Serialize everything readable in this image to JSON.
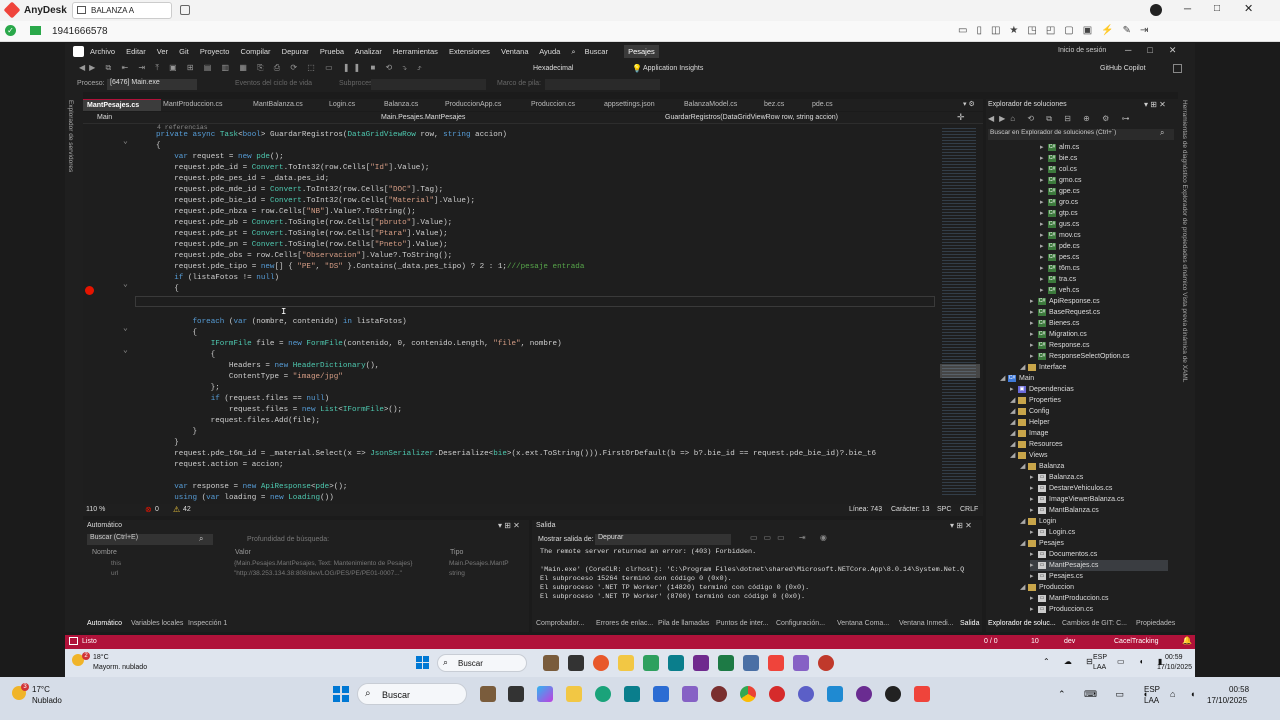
{
  "anydesk": {
    "app_name": "AnyDesk",
    "tab_title": "BALANZA A",
    "address": "1941666578"
  },
  "vs": {
    "menu": [
      "Archivo",
      "Editar",
      "Ver",
      "Git",
      "Proyecto",
      "Compilar",
      "Depurar",
      "Prueba",
      "Analizar",
      "Herramientas",
      "Extensiones",
      "Ventana",
      "Ayuda"
    ],
    "search_label": "Buscar",
    "active_menu": "Pesajes",
    "signin": "Inicio de sesión",
    "copilot": "GitHub Copilot",
    "config": "Hexadecimal",
    "insights": "Application Insights",
    "process_label": "Proceso:",
    "process_value": "[6476] Main.exe",
    "lifecycle": "Eventos del ciclo de vida",
    "thread_label": "Subproceso:",
    "stack_label": "Marco de pila:",
    "left_strip": "Explorador de servidores",
    "right_strip": "Herramientas de diagnóstico   Explorador de propiedades dinámico   Vista previa dinámica de XAML"
  },
  "tabs": [
    "MantPesajes.cs",
    "MantProduccion.cs",
    "MantBalanza.cs",
    "Login.cs",
    "Balanza.cs",
    "ProduccionApp.cs",
    "Produccion.cs",
    "appsettings.json",
    "BalanzaModel.cs",
    "bez.cs",
    "pde.cs"
  ],
  "nav": {
    "project": "Main",
    "class": "Main.Pesajes.MantPesajes",
    "method": "GuardarRegistros(DataGridViewRow row, string accion)"
  },
  "editor": {
    "references": "4 referencias",
    "lines": [
      "private async Task<bool> GuardarRegistros(DataGridViewRow row, string accion)",
      "{",
      "    var request = new pde();",
      "    request.pde_id = Convert.ToInt32(row.Cells[\"Id\"].Value);",
      "    request.pde_pes_id = _data.pes_id;",
      "    request.pde_mde_id = Convert.ToInt32(row.Cells[\"DOC\"].Tag);",
      "    request.pde_bie_id = Convert.ToInt32(row.Cells[\"Material\"].Value);",
      "    request.pde_nbza = row.Cells[\"NB\"].Value?.ToString();",
      "    request.pde_pb = Convert.ToSingle(row.Cells[\"pbruto\"].Value);",
      "    request.pde_pt = Convert.ToSingle(row.Cells[\"Ptara\"].Value);",
      "    request.pde_pn = Convert.ToSingle(row.Cells[\"Pneto\"].Value);",
      "    request.pde_obs = row.Cells[\"Observacion\"].Value?.ToString();",
      "    request.pde_tipo = new[] { \"PE\", \"DS\" }.Contains(_data.pes_tipo) ? 2 : 1;///pesaje entrada",
      "    if (listaFotos != null)",
      "    {",
      "",
      "",
      "        foreach (var (nombre, contenido) in listaFotos)",
      "        {",
      "            IFormFile file = new FormFile(contenido, 0, contenido.Length, \"file\", nombre)",
      "            {",
      "                Headers = new HeaderDictionary(),",
      "                ContentType = \"image/jpg\"",
      "            };",
      "            if (request.files == null)",
      "                request.files = new List<IFormFile>();",
      "            request.files.Add(file);",
      "        }",
      "    }",
      "    request.pde_t6m_id = _material.Select(x => JsonSerializer.Deserialize<bie>(x.ext.ToString())).FirstOrDefault(b => b?.bie_id == request.pde_bie_id)?.bie_t6",
      "    request.action = accion;",
      "",
      "    var response = new ApiResponse<pde>();",
      "    using (var loading = new Loading())"
    ],
    "zoom": "110 %",
    "errors": "0",
    "warnings": "42",
    "line_info": "Línea: 743",
    "char_info": "Carácter: 13",
    "spc": "SPC",
    "crlf": "CRLF"
  },
  "autos": {
    "title": "Automático",
    "search_placeholder": "Buscar (Ctrl+E)",
    "depth": "Profundidad de búsqueda:",
    "col_name": "Nombre",
    "col_value": "Valor",
    "col_type": "Tipo",
    "rows": [
      {
        "name": "this",
        "value": "{Main.Pesajes.MantPesajes, Text: Mantenimiento de Pesajes}",
        "type": "Main.Pesajes.MantP"
      },
      {
        "name": "url",
        "value": "\"http://38.253.134.38:808/dev/LOG/PES/PE/PE01-0007...\"",
        "type": "string"
      }
    ],
    "bottom_tabs": [
      "Automático",
      "Variables locales",
      "Inspección 1"
    ]
  },
  "output": {
    "title": "Salida",
    "show_label": "Mostrar salida de:",
    "show_value": "Depurar",
    "lines": [
      "The remote server returned an error: (403) Forbidden.",
      "",
      "'Main.exe' (CoreCLR: clrhost): 'C:\\Program Files\\dotnet\\shared\\Microsoft.NETCore.App\\8.0.14\\System.Net.Q",
      "El subproceso 15264 terminó con código 0 (0x0).",
      "El subproceso '.NET TP Worker' (14820) terminó con código 0 (0x0).",
      "El subproceso '.NET TP Worker' (8700) terminó con código 0 (0x0)."
    ],
    "bottom_tabs": [
      "Comprobador...",
      "Errores de enlac...",
      "Pila de llamadas",
      "Puntos de inter...",
      "Configuración...",
      "Ventana Coma...",
      "Ventana Inmedi...",
      "Salida"
    ]
  },
  "solution": {
    "title": "Explorador de soluciones",
    "search_placeholder": "Buscar en Explorador de soluciones (Ctrl+`)",
    "items": [
      {
        "label": "alm.cs",
        "kind": "cs",
        "level": 4
      },
      {
        "label": "bie.cs",
        "kind": "cs",
        "level": 4
      },
      {
        "label": "col.cs",
        "kind": "cs",
        "level": 4
      },
      {
        "label": "gmo.cs",
        "kind": "cs",
        "level": 4
      },
      {
        "label": "gpe.cs",
        "kind": "cs",
        "level": 4
      },
      {
        "label": "gro.cs",
        "kind": "cs",
        "level": 4
      },
      {
        "label": "gtp.cs",
        "kind": "cs",
        "level": 4
      },
      {
        "label": "gus.cs",
        "kind": "cs",
        "level": 4
      },
      {
        "label": "mov.cs",
        "kind": "cs",
        "level": 4
      },
      {
        "label": "pde.cs",
        "kind": "cs",
        "level": 4
      },
      {
        "label": "pes.cs",
        "kind": "cs",
        "level": 4
      },
      {
        "label": "t6m.cs",
        "kind": "cs",
        "level": 4
      },
      {
        "label": "tra.cs",
        "kind": "cs",
        "level": 4
      },
      {
        "label": "veh.cs",
        "kind": "cs",
        "level": 4
      },
      {
        "label": "ApiResponse.cs",
        "kind": "cs",
        "level": 3
      },
      {
        "label": "BaseRequest.cs",
        "kind": "cs",
        "level": 3
      },
      {
        "label": "Bienes.cs",
        "kind": "cs",
        "level": 3
      },
      {
        "label": "Migration.cs",
        "kind": "cs",
        "level": 3
      },
      {
        "label": "Response.cs",
        "kind": "cs",
        "level": 3
      },
      {
        "label": "ResponseSelectOption.cs",
        "kind": "cs",
        "level": 3
      },
      {
        "label": "Interface",
        "kind": "folder",
        "level": 2
      },
      {
        "label": "Main",
        "kind": "project",
        "level": 0
      },
      {
        "label": "Dependencias",
        "kind": "deps",
        "level": 1
      },
      {
        "label": "Properties",
        "kind": "folder",
        "level": 1
      },
      {
        "label": "Config",
        "kind": "folder",
        "level": 1
      },
      {
        "label": "Helper",
        "kind": "folder",
        "level": 1
      },
      {
        "label": "Image",
        "kind": "folder",
        "level": 1
      },
      {
        "label": "Resources",
        "kind": "folder",
        "level": 1
      },
      {
        "label": "Views",
        "kind": "folder",
        "level": 1
      },
      {
        "label": "Balanza",
        "kind": "folder",
        "level": 2
      },
      {
        "label": "Balanza.cs",
        "kind": "form",
        "level": 3
      },
      {
        "label": "DestareVehiculos.cs",
        "kind": "form",
        "level": 3
      },
      {
        "label": "ImageViewerBalanza.cs",
        "kind": "form",
        "level": 3
      },
      {
        "label": "MantBalanza.cs",
        "kind": "form",
        "level": 3
      },
      {
        "label": "Login",
        "kind": "folder",
        "level": 2
      },
      {
        "label": "Login.cs",
        "kind": "form",
        "level": 3
      },
      {
        "label": "Pesajes",
        "kind": "folder",
        "level": 2
      },
      {
        "label": "Documentos.cs",
        "kind": "form",
        "level": 3
      },
      {
        "label": "MantPesajes.cs",
        "kind": "form",
        "level": 3
      },
      {
        "label": "Pesajes.cs",
        "kind": "form",
        "level": 3
      },
      {
        "label": "Produccion",
        "kind": "folder",
        "level": 2
      },
      {
        "label": "MantProduccion.cs",
        "kind": "form",
        "level": 3
      },
      {
        "label": "Produccion.cs",
        "kind": "form",
        "level": 3
      }
    ],
    "bottom_tabs": [
      "Explorador de soluc...",
      "Cambios de GIT: C...",
      "Propiedades"
    ]
  },
  "statusbar": {
    "ready": "Listo",
    "changes": "0 / 0",
    "pending": "10",
    "branch": "dev",
    "repo": "CacelTracking"
  },
  "taskbar_inner": {
    "temp": "18°C",
    "weather": "Mayorm. nublado",
    "badge": "2",
    "search": "Buscar",
    "lang": "ESP",
    "lang2": "LAA",
    "time": "00:59",
    "date": "17/10/2025"
  },
  "taskbar_outer": {
    "temp": "17°C",
    "weather": "Nublado",
    "badge": "3",
    "search": "Buscar",
    "lang": "ESP",
    "lang2": "LAA",
    "time": "00:58",
    "date": "17/10/2025"
  },
  "colors": {
    "accent": "#b0123a",
    "editor_bg": "#1e1e1e",
    "keyword": "#569cd6",
    "type": "#4ec9b0",
    "string": "#d69d85",
    "breakpoint": "#e51400"
  }
}
